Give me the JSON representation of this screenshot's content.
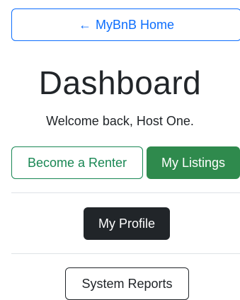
{
  "home_button": {
    "arrow": "←",
    "label": "MyBnB Home"
  },
  "page_title": "Dashboard",
  "welcome_text": "Welcome back, Host One.",
  "actions": {
    "become_renter": "Become a Renter",
    "my_listings": "My Listings",
    "my_profile": "My Profile",
    "system_reports": "System Reports"
  },
  "colors": {
    "primary": "#0d6efd",
    "success": "#198754",
    "success_fill": "#2f8a4d",
    "dark": "#212529",
    "divider": "#dee2e6"
  }
}
